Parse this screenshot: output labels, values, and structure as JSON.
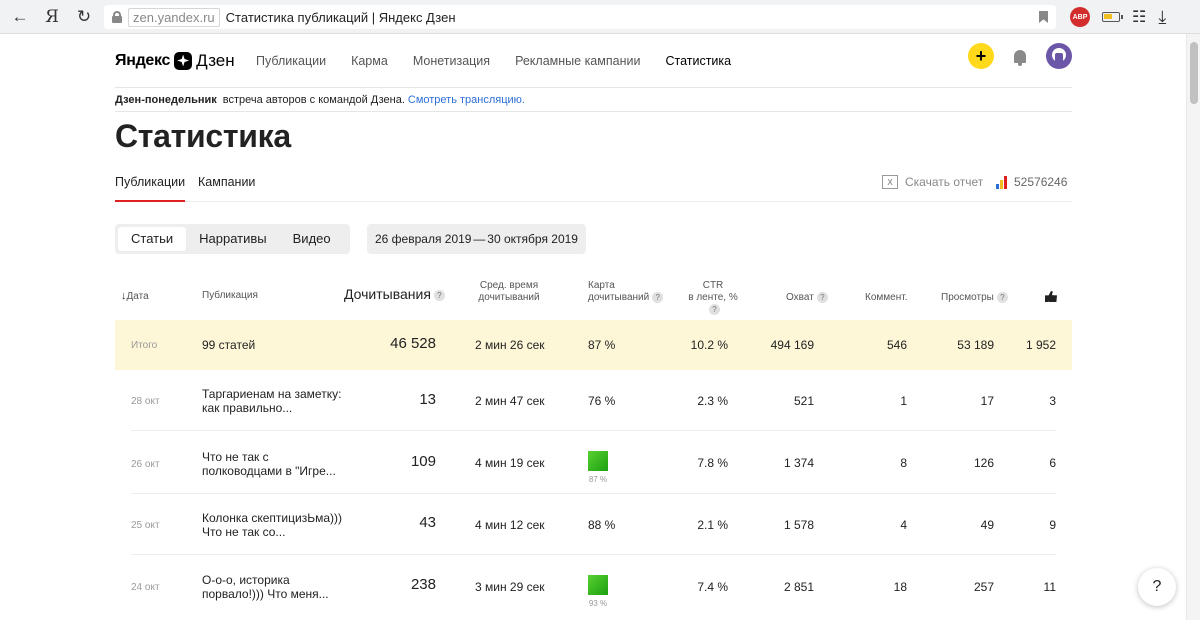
{
  "browser": {
    "back_icon": "arrow-left-icon",
    "yandex_logo": "Я",
    "url_domain": "zen.yandex.ru",
    "page_title": "Статистика публикаций | Яндекс Дзен",
    "abp_label": "ABP"
  },
  "header": {
    "logo_part1": "Яндекс",
    "logo_part2": "Дзен",
    "nav": [
      "Публикации",
      "Карма",
      "Монетизация",
      "Рекламные кампании",
      "Статистика"
    ],
    "active_nav": "Статистика"
  },
  "announcement": {
    "title": "Дзен-понедельник",
    "text": "встреча авторов с командой Дзена.",
    "link": "Смотреть трансляцию."
  },
  "page": {
    "title": "Статистика",
    "tabs": [
      "Публикации",
      "Кампании"
    ],
    "download_label": "Скачать отчет",
    "counter": "52576246"
  },
  "filters": {
    "types": [
      "Статьи",
      "Нарративы",
      "Видео"
    ],
    "date_from": "26 февраля 2019",
    "date_sep": "—",
    "date_to": "30 октября 2019"
  },
  "table": {
    "headers": {
      "date": "Дата",
      "publication": "Публикация",
      "reads": "Дочитывания",
      "avg_time_1": "Сред. время",
      "avg_time_2": "дочитываний",
      "map_1": "Карта",
      "map_2": "дочитываний",
      "ctr_1": "CTR",
      "ctr_2": "в ленте, %",
      "reach": "Охват",
      "comments": "Коммент.",
      "views": "Просмотры",
      "q": "?"
    },
    "total": {
      "label": "Итого",
      "publication": "99 статей",
      "reads": "46 528",
      "avg_time": "2 мин 26 сек",
      "map": "87 %",
      "ctr": "10.2 %",
      "reach": "494 169",
      "comments": "546",
      "views": "53 189",
      "likes": "1 952"
    },
    "rows": [
      {
        "date": "28 окт",
        "pub1": "Таргариенам на заметку:",
        "pub2": "как правильно...",
        "reads": "13",
        "avg_time": "2 мин 47 сек",
        "map": "76 %",
        "ctr": "2.3 %",
        "reach": "521",
        "comments": "1",
        "views": "17",
        "likes": "3"
      },
      {
        "date": "26 окт",
        "pub1": "Что не так с",
        "pub2": "полководцами в \"Игре...",
        "reads": "109",
        "avg_time": "4 мин 19 сек",
        "map": "87 %",
        "ctr": "7.8 %",
        "reach": "1 374",
        "comments": "8",
        "views": "126",
        "likes": "6"
      },
      {
        "date": "25 окт",
        "pub1": "Колонка скептицизЬма)))",
        "pub2": "Что не так со...",
        "reads": "43",
        "avg_time": "4 мин 12 сек",
        "map": "88 %",
        "ctr": "2.1 %",
        "reach": "1 578",
        "comments": "4",
        "views": "49",
        "likes": "9"
      },
      {
        "date": "24 окт",
        "pub1": "О-о-о, историка",
        "pub2": "порвало!))) Что меня...",
        "reads": "238",
        "avg_time": "3 мин 29 сек",
        "map": "93 %",
        "ctr": "7.4 %",
        "reach": "2 851",
        "comments": "18",
        "views": "257",
        "likes": "11"
      }
    ]
  },
  "help": "?"
}
